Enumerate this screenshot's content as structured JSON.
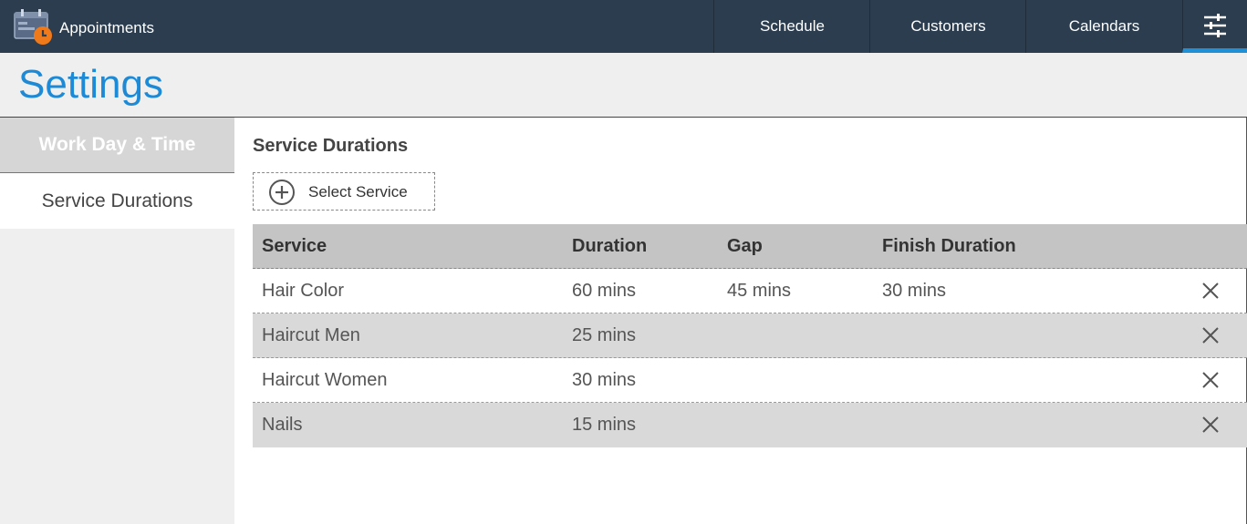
{
  "header": {
    "app_title": "Appointments",
    "nav": {
      "schedule": "Schedule",
      "customers": "Customers",
      "calendars": "Calendars"
    }
  },
  "page": {
    "title": "Settings"
  },
  "sidebar": {
    "items": [
      {
        "label": "Work Day & Time"
      },
      {
        "label": "Service Durations"
      }
    ]
  },
  "main": {
    "section_title": "Service Durations",
    "select_service_label": "Select Service",
    "table": {
      "headers": [
        "Service",
        "Duration",
        "Gap",
        "Finish Duration"
      ],
      "rows": [
        {
          "service": "Hair Color",
          "duration": "60 mins",
          "gap": "45 mins",
          "finish": "30 mins"
        },
        {
          "service": "Haircut Men",
          "duration": "25 mins",
          "gap": "",
          "finish": ""
        },
        {
          "service": "Haircut Women",
          "duration": "30 mins",
          "gap": "",
          "finish": ""
        },
        {
          "service": "Nails",
          "duration": "15 mins",
          "gap": "",
          "finish": ""
        }
      ]
    }
  },
  "icons": {
    "app": "calendar-clock-icon",
    "settings": "sliders-icon",
    "add": "plus-circle-icon",
    "delete": "close-icon"
  },
  "colors": {
    "topbar": "#2b3d4f",
    "accent": "#1e8ad6",
    "clock": "#f07a1a"
  }
}
